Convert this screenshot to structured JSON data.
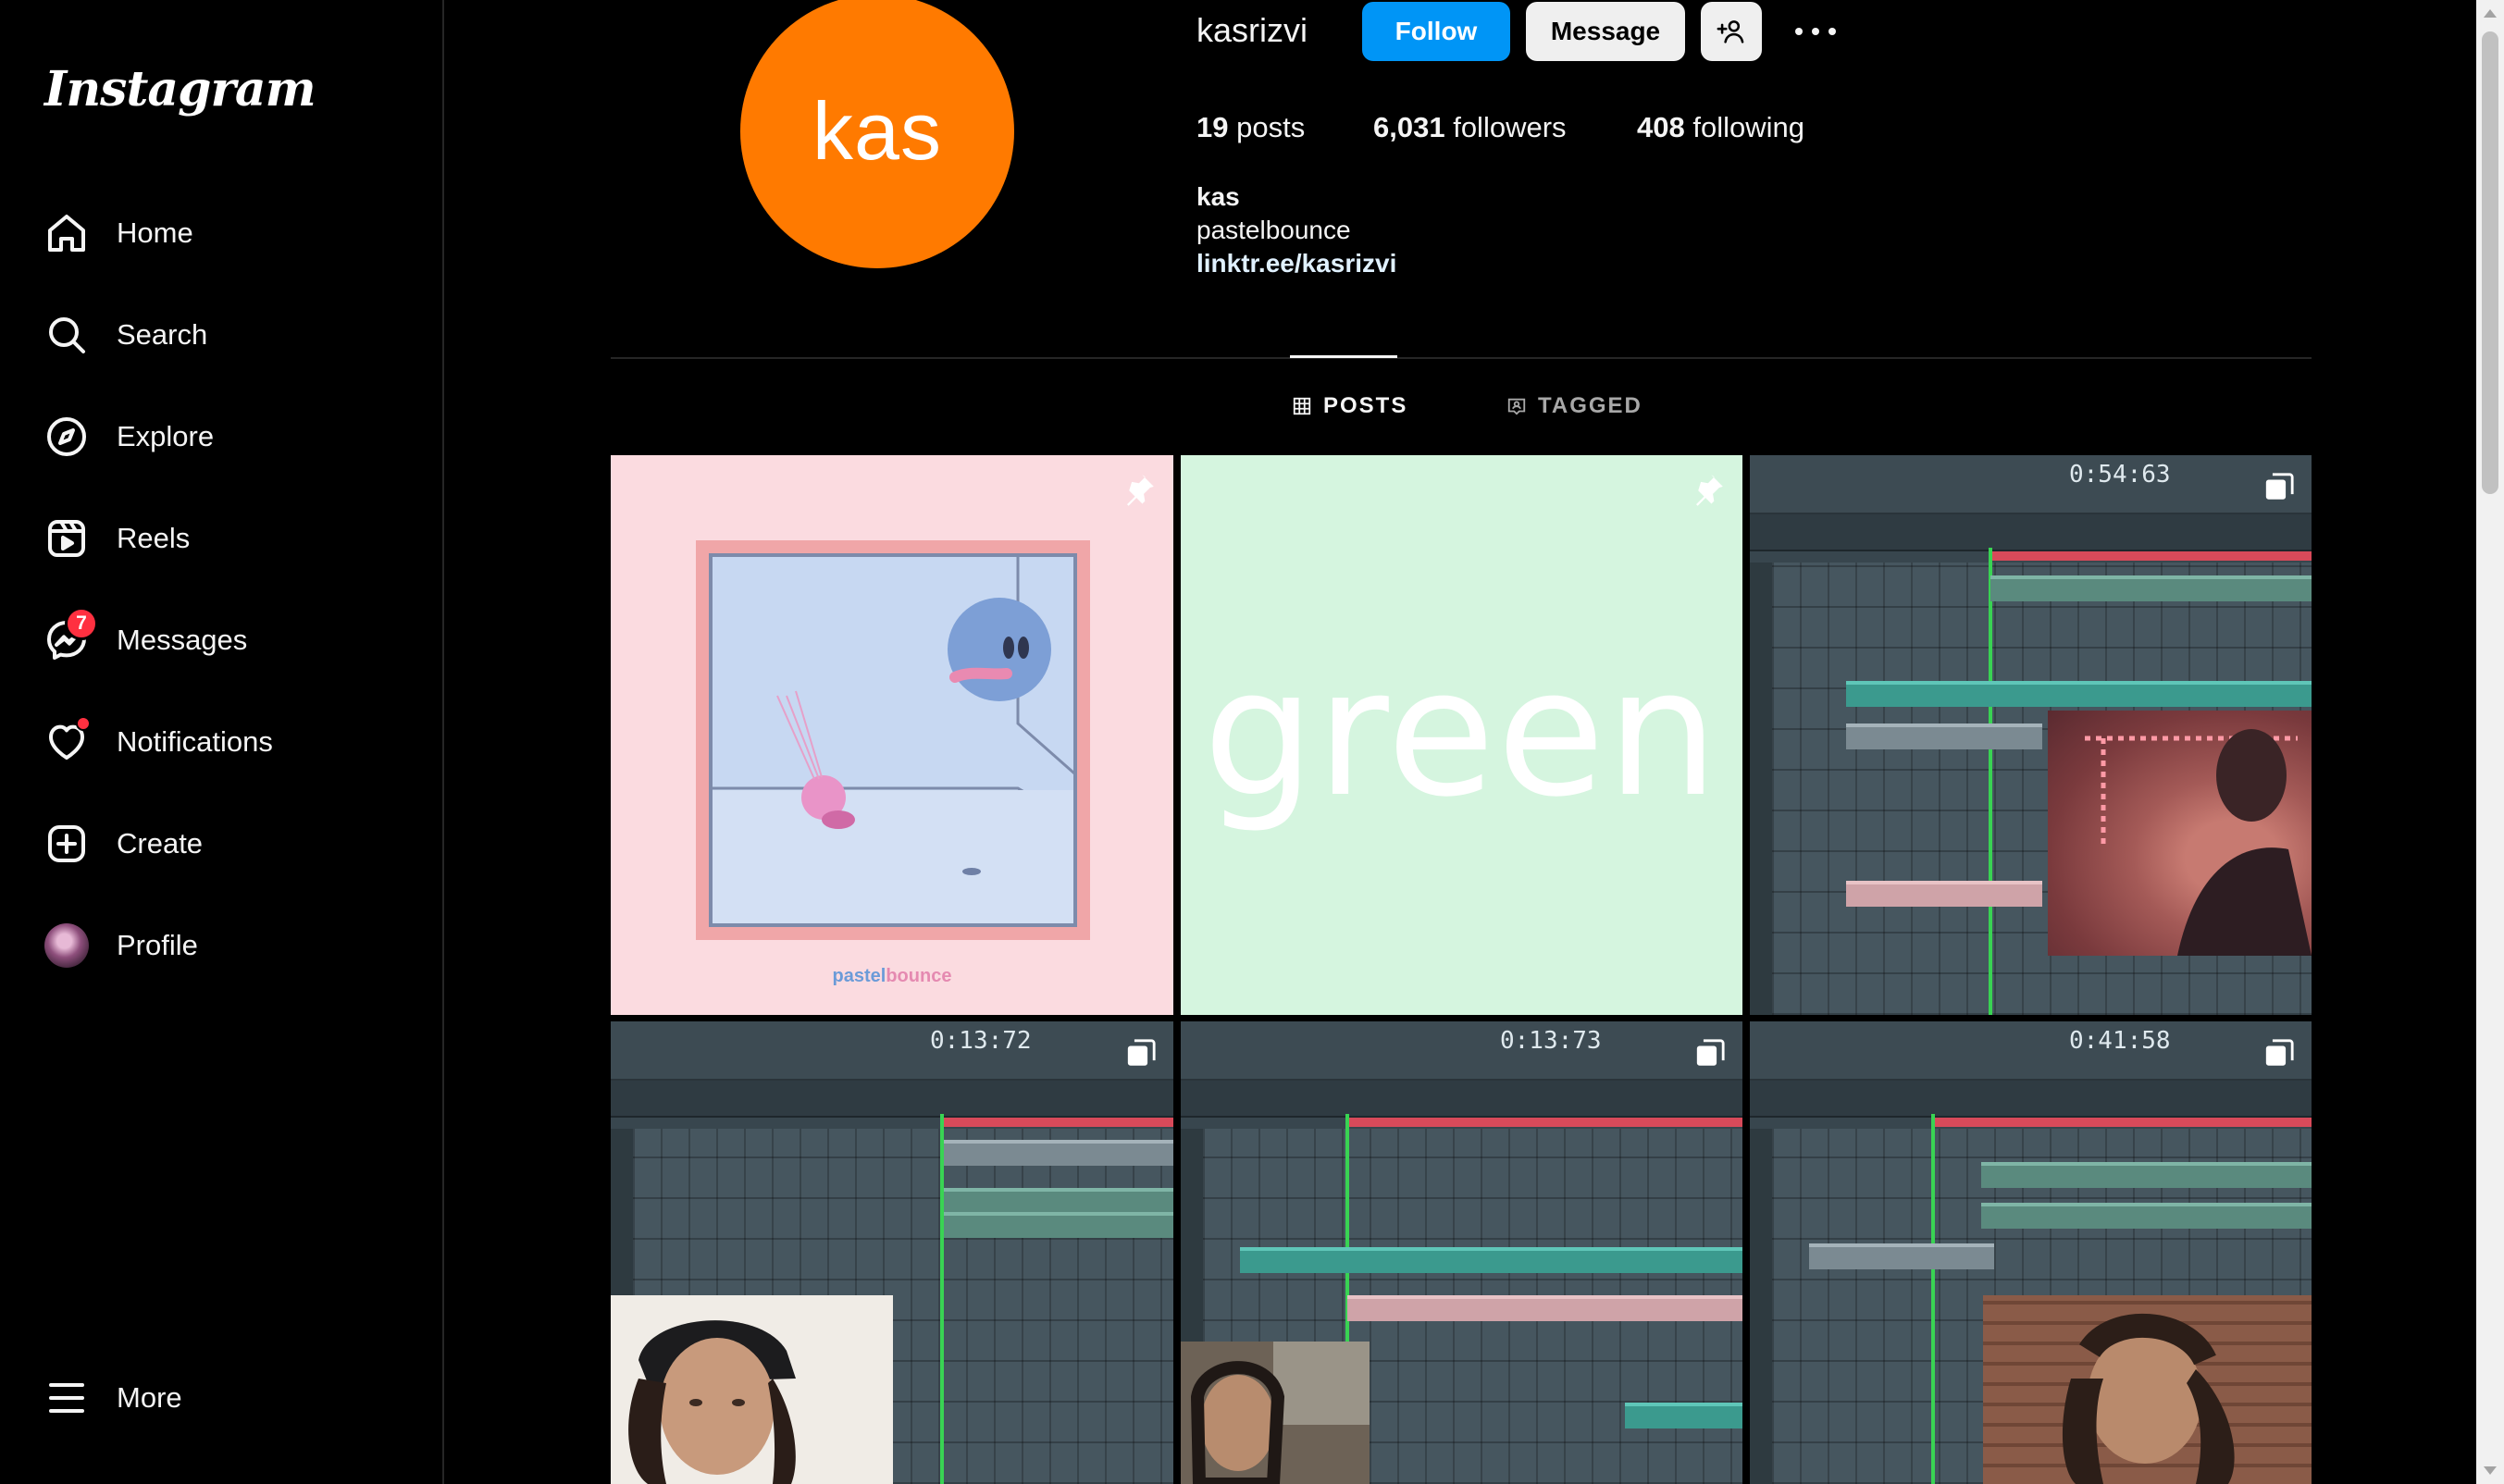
{
  "sidebar": {
    "logo": "Instagram",
    "items": [
      {
        "label": "Home",
        "icon": "home-icon"
      },
      {
        "label": "Search",
        "icon": "search-icon"
      },
      {
        "label": "Explore",
        "icon": "compass-icon"
      },
      {
        "label": "Reels",
        "icon": "reels-icon"
      },
      {
        "label": "Messages",
        "icon": "messenger-icon",
        "badge": "7"
      },
      {
        "label": "Notifications",
        "icon": "heart-icon"
      },
      {
        "label": "Create",
        "icon": "plus-square-icon"
      },
      {
        "label": "Profile",
        "icon": "avatar"
      }
    ],
    "more": {
      "label": "More",
      "icon": "hamburger-icon"
    }
  },
  "profile": {
    "avatar_text": "kas",
    "avatar_color": "#ff7a00",
    "username": "kasrizvi",
    "follow_label": "Follow",
    "message_label": "Message",
    "stats": {
      "posts_count": "19",
      "posts_label": "posts",
      "followers_count": "6,031",
      "followers_label": "followers",
      "following_count": "408",
      "following_label": "following"
    },
    "bio": {
      "name": "kas",
      "line": "pastelbounce",
      "link": "linktr.ee/kasrizvi"
    }
  },
  "tabs": [
    {
      "label": "POSTS",
      "active": true
    },
    {
      "label": "TAGGED",
      "active": false
    }
  ],
  "posts": [
    {
      "type": "artwork",
      "pinned": true,
      "caption_part1": "pastel",
      "caption_part2": "bounce"
    },
    {
      "type": "text",
      "pinned": true,
      "text": "green"
    },
    {
      "type": "video",
      "multi": true,
      "time": "0:54:63"
    },
    {
      "type": "video",
      "multi": true,
      "time": "0:13:72"
    },
    {
      "type": "video",
      "multi": true,
      "time": "0:13:73"
    },
    {
      "type": "video",
      "multi": true,
      "time": "0:41:58"
    }
  ],
  "colors": {
    "follow_button": "#0095f6",
    "badge": "#ff3040",
    "background": "#000000"
  }
}
